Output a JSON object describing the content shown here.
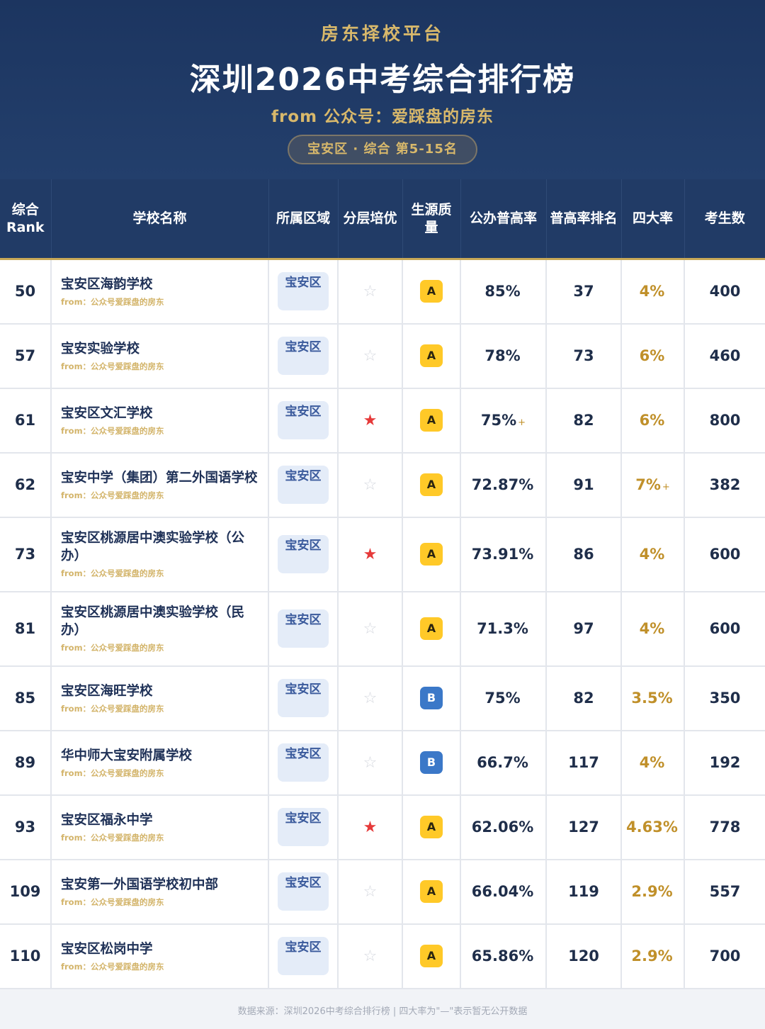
{
  "header": {
    "platform": "房东择校平台",
    "title": "深圳2026中考综合排行榜",
    "source": "from 公众号：爱踩盘的房东",
    "range": "宝安区 · 综合 第5-15名"
  },
  "columns": [
    "综合Rank",
    "学校名称",
    "所属区域",
    "分层培优",
    "生源质量",
    "公办普高率",
    "普高率排名",
    "四大率",
    "考生数"
  ],
  "rows": [
    {
      "rank": "50",
      "name": "宝安区海韵学校",
      "from": "from：公众号爱踩盘的房东",
      "district": "宝安区",
      "star": false,
      "grade": "A",
      "rate": "85%",
      "rate_plus": "",
      "rate_rank": "37",
      "big4": "4%",
      "big4_plus": "",
      "students": "400"
    },
    {
      "rank": "57",
      "name": "宝安实验学校",
      "from": "from：公众号爱踩盘的房东",
      "district": "宝安区",
      "star": false,
      "grade": "A",
      "rate": "78%",
      "rate_plus": "",
      "rate_rank": "73",
      "big4": "6%",
      "big4_plus": "",
      "students": "460"
    },
    {
      "rank": "61",
      "name": "宝安区文汇学校",
      "from": "from：公众号爱踩盘的房东",
      "district": "宝安区",
      "star": true,
      "grade": "A",
      "rate": "75%",
      "rate_plus": "+",
      "rate_rank": "82",
      "big4": "6%",
      "big4_plus": "",
      "students": "800"
    },
    {
      "rank": "62",
      "name": "宝安中学（集团）第二外国语学校",
      "from": "from：公众号爱踩盘的房东",
      "district": "宝安区",
      "star": false,
      "grade": "A",
      "rate": "72.87%",
      "rate_plus": "",
      "rate_rank": "91",
      "big4": "7%",
      "big4_plus": "+",
      "students": "382"
    },
    {
      "rank": "73",
      "name": "宝安区桃源居中澳实验学校（公办）",
      "from": "from：公众号爱踩盘的房东",
      "district": "宝安区",
      "star": true,
      "grade": "A",
      "rate": "73.91%",
      "rate_plus": "",
      "rate_rank": "86",
      "big4": "4%",
      "big4_plus": "",
      "students": "600"
    },
    {
      "rank": "81",
      "name": "宝安区桃源居中澳实验学校（民办）",
      "from": "from：公众号爱踩盘的房东",
      "district": "宝安区",
      "star": false,
      "grade": "A",
      "rate": "71.3%",
      "rate_plus": "",
      "rate_rank": "97",
      "big4": "4%",
      "big4_plus": "",
      "students": "600"
    },
    {
      "rank": "85",
      "name": "宝安区海旺学校",
      "from": "from：公众号爱踩盘的房东",
      "district": "宝安区",
      "star": false,
      "grade": "B",
      "rate": "75%",
      "rate_plus": "",
      "rate_rank": "82",
      "big4": "3.5%",
      "big4_plus": "",
      "students": "350"
    },
    {
      "rank": "89",
      "name": "华中师大宝安附属学校",
      "from": "from：公众号爱踩盘的房东",
      "district": "宝安区",
      "star": false,
      "grade": "B",
      "rate": "66.7%",
      "rate_plus": "",
      "rate_rank": "117",
      "big4": "4%",
      "big4_plus": "",
      "students": "192"
    },
    {
      "rank": "93",
      "name": "宝安区福永中学",
      "from": "from：公众号爱踩盘的房东",
      "district": "宝安区",
      "star": true,
      "grade": "A",
      "rate": "62.06%",
      "rate_plus": "",
      "rate_rank": "127",
      "big4": "4.63%",
      "big4_plus": "",
      "students": "778"
    },
    {
      "rank": "109",
      "name": "宝安第一外国语学校初中部",
      "from": "from：公众号爱踩盘的房东",
      "district": "宝安区",
      "star": false,
      "grade": "A",
      "rate": "66.04%",
      "rate_plus": "",
      "rate_rank": "119",
      "big4": "2.9%",
      "big4_plus": "",
      "students": "557"
    },
    {
      "rank": "110",
      "name": "宝安区松岗中学",
      "from": "from：公众号爱踩盘的房东",
      "district": "宝安区",
      "star": false,
      "grade": "A",
      "rate": "65.86%",
      "rate_plus": "",
      "rate_rank": "120",
      "big4": "2.9%",
      "big4_plus": "",
      "students": "700"
    }
  ],
  "star_glyph_on": "★",
  "star_glyph_off": "☆",
  "colors": {
    "star_on": "#e63a3a",
    "grade_A": "#ffc928",
    "grade_B": "#3b78c8",
    "gold": "#c0902a"
  },
  "footer": "数据来源：深圳2026中考综合排行榜 | 四大率为\"—\"表示暂无公开数据"
}
